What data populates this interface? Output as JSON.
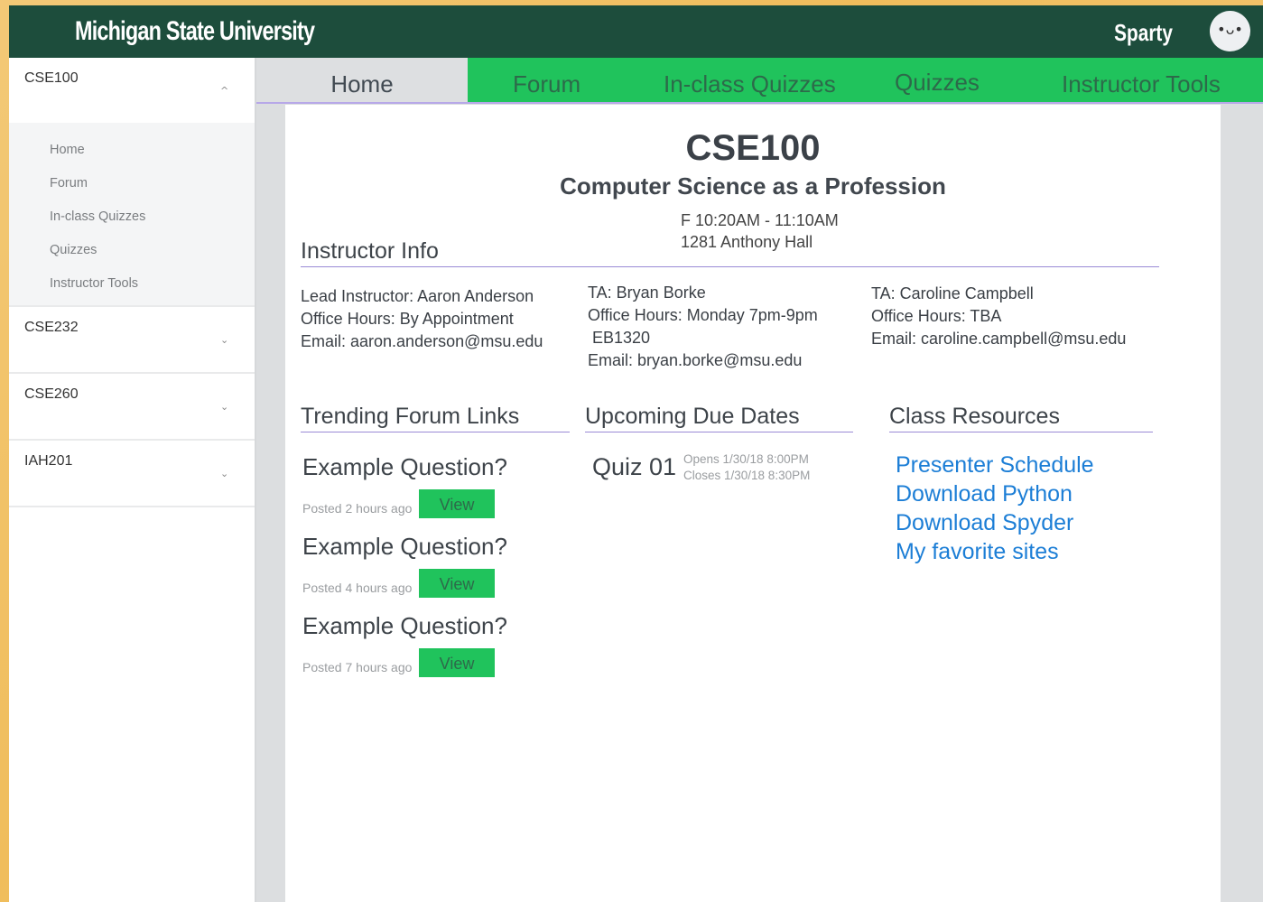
{
  "header": {
    "brand": "Michigan State University",
    "username": "Sparty",
    "avatar_face": "•ᴗ•"
  },
  "sidebar": {
    "courses": [
      {
        "title": "CSE100",
        "expanded": true,
        "chevron": "^"
      },
      {
        "title": "CSE232",
        "expanded": false,
        "chevron": "⌄"
      },
      {
        "title": "CSE260",
        "expanded": false,
        "chevron": "⌄"
      },
      {
        "title": "IAH201",
        "expanded": false,
        "chevron": "⌄"
      }
    ],
    "submenu": [
      "Home",
      "Forum",
      "In-class Quizzes",
      "Quizzes",
      "Instructor Tools"
    ]
  },
  "tabs": [
    "Home",
    "Forum",
    "In-class Quizzes",
    "Quizzes",
    "Instructor Tools"
  ],
  "course": {
    "code": "CSE100",
    "name": "Computer Science as a Profession",
    "time": "F 10:20AM - 11:10AM",
    "room": "1281 Anthony Hall"
  },
  "instructor_info": {
    "heading": "Instructor Info",
    "people": [
      {
        "line1": "Lead Instructor: Aaron Anderson",
        "line2": "Office Hours: By Appointment",
        "line3": "Email: aaron.anderson@msu.edu",
        "line4": ""
      },
      {
        "line1": "TA: Bryan Borke",
        "line2": "Office Hours: Monday 7pm-9pm",
        "line3": " EB1320",
        "line4": "Email: bryan.borke@msu.edu"
      },
      {
        "line1": "TA: Caroline Campbell",
        "line2": "Office Hours: TBA",
        "line3": "Email: caroline.campbell@msu.edu",
        "line4": ""
      }
    ]
  },
  "forum": {
    "heading": "Trending Forum Links",
    "posts": [
      {
        "title": "Example Question?",
        "meta": "Posted 2 hours ago",
        "button": "View"
      },
      {
        "title": "Example Question?",
        "meta": "Posted 4 hours ago",
        "button": "View"
      },
      {
        "title": "Example Question?",
        "meta": "Posted 7 hours ago",
        "button": "View"
      }
    ]
  },
  "due": {
    "heading": "Upcoming Due Dates",
    "items": [
      {
        "name": "Quiz 01",
        "opens": "Opens 1/30/18 8:00PM",
        "closes": "Closes 1/30/18 8:30PM"
      }
    ]
  },
  "resources": {
    "heading": "Class Resources",
    "links": [
      "Presenter Schedule",
      "Download Python",
      "Download Spyder",
      "My favorite sites"
    ]
  }
}
